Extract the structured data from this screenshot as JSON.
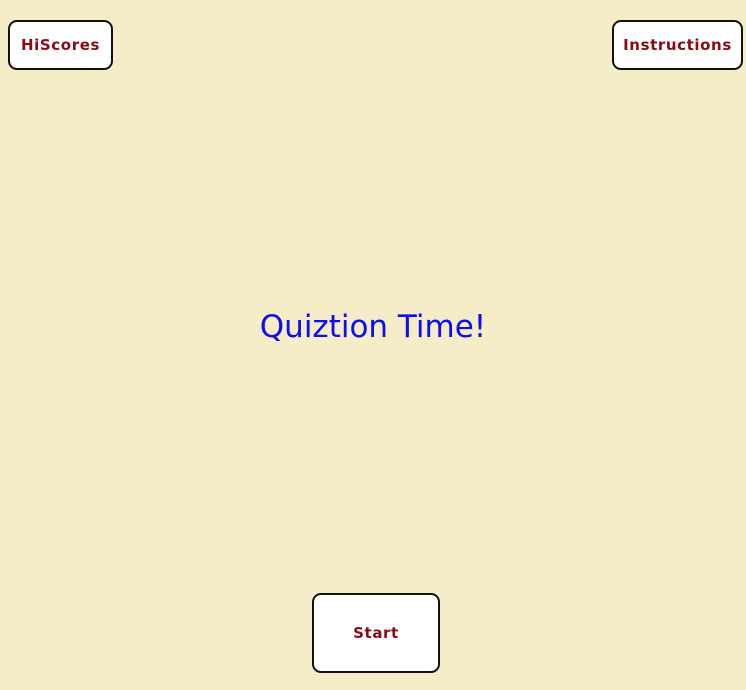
{
  "header": {
    "hiscores_label": "HiScores",
    "instructions_label": "Instructions"
  },
  "main": {
    "title": "Quiztion Time!"
  },
  "footer": {
    "start_label": "Start"
  },
  "colors": {
    "background": "#f5edc7",
    "button_text": "#8b0a12",
    "title": "#0d0df2"
  }
}
